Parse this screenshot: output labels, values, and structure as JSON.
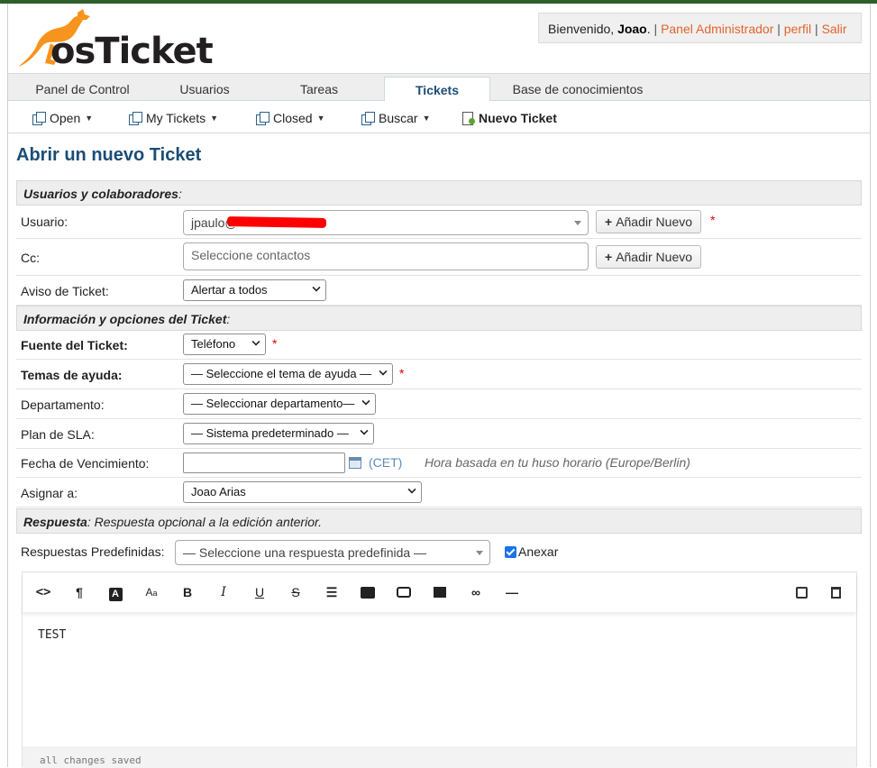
{
  "header": {
    "logo_text": "osTicket",
    "welcome_prefix": "Bienvenido, ",
    "user_name": "Joao",
    "admin_panel": "Panel Administrador",
    "profile": "perfil",
    "logout": "Salir"
  },
  "nav": {
    "tabs": [
      {
        "label": "Panel de Control"
      },
      {
        "label": "Usuarios"
      },
      {
        "label": "Tareas"
      },
      {
        "label": "Tickets"
      },
      {
        "label": "Base de conocimientos"
      }
    ],
    "active": "Tickets"
  },
  "subnav": {
    "open": "Open",
    "my_tickets": "My Tickets",
    "closed": "Closed",
    "search": "Buscar",
    "new_ticket": "Nuevo Ticket"
  },
  "page_title": "Abrir un nuevo Ticket",
  "sections": {
    "users": "Usuarios y colaboradores",
    "info": "Información y opciones del Ticket",
    "response_bold": "Respuesta",
    "response_rest": ": Respuesta opcional a la edición anterior."
  },
  "fields": {
    "user_label": "Usuario:",
    "user_value": "jpaulo@",
    "add_new": "Añadir Nuevo",
    "cc_label": "Cc:",
    "cc_placeholder": "Seleccione contactos",
    "notice_label": "Aviso de Ticket:",
    "notice_value": "Alertar a todos",
    "source_label": "Fuente del Ticket:",
    "source_value": "Teléfono",
    "topic_label": "Temas de ayuda:",
    "topic_value": "— Seleccione el tema de ayuda —",
    "dept_label": "Departamento:",
    "dept_value": "— Seleccionar departamento—",
    "sla_label": "Plan de SLA:",
    "sla_value": "— Sistema predeterminado —",
    "due_label": "Fecha de Vencimiento:",
    "due_value": "",
    "timezone": "(CET)",
    "tz_hint": "Hora basada en tu huso horario (Europe/Berlin)",
    "assign_label": "Asignar a:",
    "assign_value": "Joao Arias",
    "canned_label": "Respuestas Predefinidas:",
    "canned_value": "— Seleccione una respuesta predefinida —",
    "attach_label": "Anexar",
    "attach_checked": true,
    "required_mark": "*"
  },
  "editor": {
    "toolbar": [
      "code-view-icon",
      "paragraph-icon",
      "text-color-icon",
      "font-size-icon",
      "bold-icon",
      "italic-icon",
      "underline-icon",
      "strikethrough-icon",
      "list-icon",
      "image-icon",
      "video-icon",
      "table-icon",
      "link-icon",
      "horizontal-rule-icon",
      "save-draft-icon",
      "delete-draft-icon"
    ],
    "content": "TEST",
    "status": "all changes saved"
  }
}
